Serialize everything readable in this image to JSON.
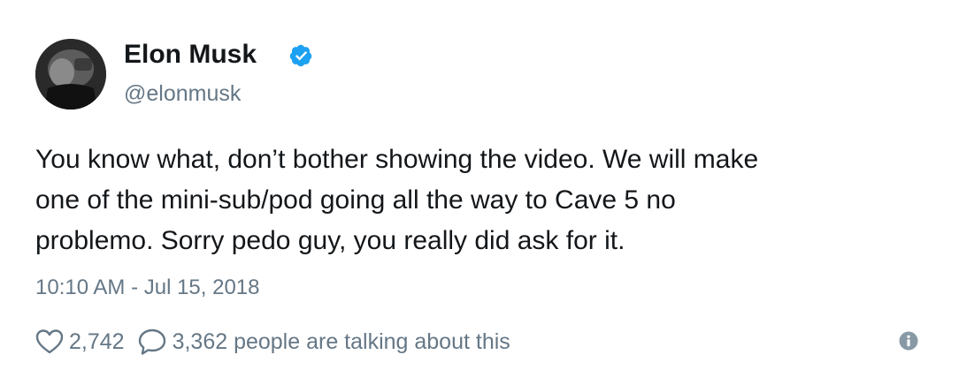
{
  "author": {
    "name": "Elon Musk",
    "handle": "@elonmusk",
    "verified_icon": "verified-badge-icon",
    "avatar_icon": "profile-photo"
  },
  "tweet": {
    "lines": [
      "You know what, don’t bother showing the video. We will make",
      "one of the mini-sub/pod going all the way to Cave 5 no",
      "problemo. Sorry pedo guy, you really did ask for it."
    ],
    "timestamp": "10:10 AM - Jul 15, 2018"
  },
  "actions": {
    "like_icon": "heart-icon",
    "like_count": "2,742",
    "reply_icon": "speech-bubble-icon",
    "talking_text": "3,362 people are talking about this",
    "info_icon": "info-icon"
  },
  "colors": {
    "text": "#14171a",
    "secondary": "#657786",
    "verified": "#1da1f2",
    "background": "#ffffff"
  }
}
